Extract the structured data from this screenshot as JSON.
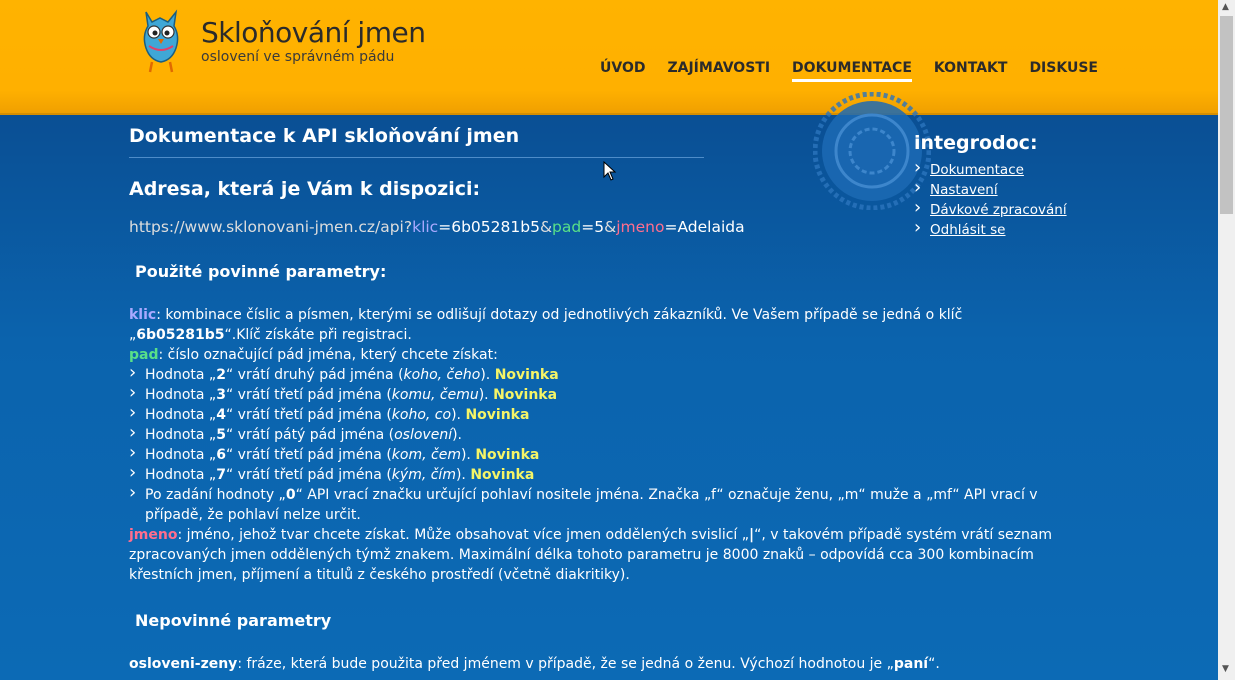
{
  "header": {
    "title": "Skloňování jmen",
    "subtitle": "oslovení ve správném pádu",
    "nav": [
      "ÚVOD",
      "ZAJÍMAVOSTI",
      "DOKUMENTACE",
      "KONTAKT",
      "DISKUSE"
    ]
  },
  "main": {
    "title": "Dokumentace k API skloňování jmen",
    "address_heading": "Adresa, která je Vám k dispozici:",
    "url": {
      "base": "https://www.sklonovani-jmen.cz/api?",
      "p1": "klic",
      "eq1": "=",
      "v1": "6b05281b5",
      "amp1": "&",
      "p2": "pad",
      "eq2": "=",
      "v2": "5",
      "amp2": "&",
      "p3": "jmeno",
      "eq3": "=",
      "v3": "Adelaida"
    },
    "required_heading": "Použité povinné parametry:",
    "klic": {
      "name": "klic",
      "t1": ": kombinace číslic a písmen, kterými se odlišují dotazy od jednotlivých zákazníků. Ve Vašem případě se jedná o klíč „",
      "key": "6b05281b5",
      "t2": "“.Klíč získáte při registraci."
    },
    "pad": {
      "name": "pad",
      "text": ": číslo označující pád jména, který chcete získat:"
    },
    "bullets": [
      {
        "pre": "Hodnota „",
        "n": "2",
        "mid": "“ vrátí druhý pád jména (",
        "ex": "koho, čeho",
        "post": "). ",
        "badge": "Novinka"
      },
      {
        "pre": "Hodnota „",
        "n": "3",
        "mid": "“ vrátí třetí pád jména (",
        "ex": "komu, čemu",
        "post": "). ",
        "badge": "Novinka"
      },
      {
        "pre": "Hodnota „",
        "n": "4",
        "mid": "“ vrátí třetí pád jména (",
        "ex": "koho, co",
        "post": "). ",
        "badge": "Novinka"
      },
      {
        "pre": "Hodnota „",
        "n": "5",
        "mid": "“ vrátí pátý pád jména (",
        "ex": "oslovení",
        "post": ").",
        "badge": ""
      },
      {
        "pre": "Hodnota „",
        "n": "6",
        "mid": "“ vrátí třetí pád jména (",
        "ex": "kom, čem",
        "post": "). ",
        "badge": "Novinka"
      },
      {
        "pre": "Hodnota „",
        "n": "7",
        "mid": "“ vrátí třetí pád jména (",
        "ex": "kým, čím",
        "post": "). ",
        "badge": "Novinka"
      }
    ],
    "bullet_zero": {
      "pre": "Po zadání hodnoty „",
      "n": "0",
      "post": "“ API vrací značku určující pohlaví nositele jména. Značka „f“ označuje ženu, „m“ muže a „mf“ API vrací v případě, že pohlaví nelze určit."
    },
    "jmeno": {
      "name": "jmeno",
      "t1": ": jméno, jehož tvar chcete získat. Může obsahovat více jmen oddělených svislicí „",
      "sep": "|",
      "t2": "“, v takovém případě systém vrátí seznam zpracovaných jmen oddělených týmž znakem. Maximální délka tohoto parametru je 8000 znaků – odpovídá cca 300 kombinacím křestních jmen, příjmení a titulů z českého prostředí (včetně diakritiky)."
    },
    "optional_heading": "Nepovinné parametry",
    "osloveni": {
      "name": "osloveni-zeny",
      "t1": ": fráze, která bude použita před jménem v případě, že se jedná o ženu. Výchozí hodnotou je „",
      "val": "paní",
      "t2": "“."
    }
  },
  "sidebar": {
    "title": "integrodoc:",
    "links": [
      "Dokumentace",
      "Nastavení",
      "Dávkové zpracování",
      "Odhlásit se"
    ]
  }
}
